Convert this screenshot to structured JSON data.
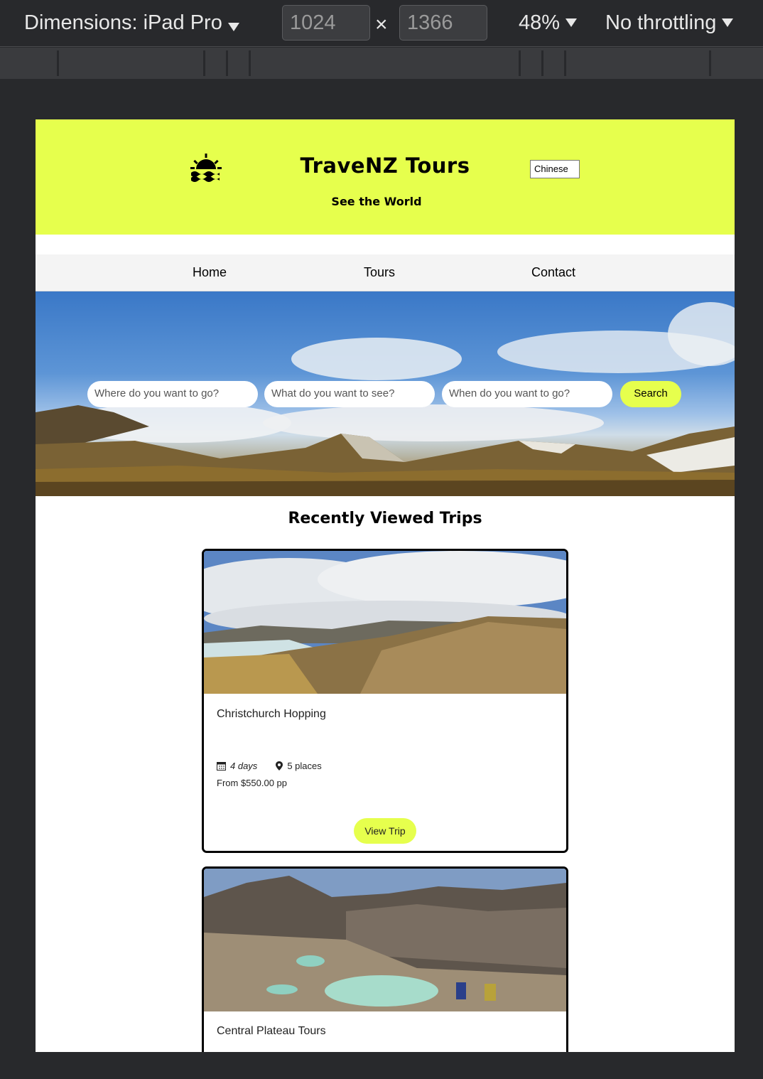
{
  "devtools": {
    "dimensions_label": "Dimensions: iPad Pro",
    "width": "1024",
    "height": "1366",
    "times": "×",
    "zoom": "48%",
    "throttling": "No throttling"
  },
  "header": {
    "title": "TraveNZ Tours",
    "tagline": "See the World",
    "language": "Chinese"
  },
  "nav": {
    "items": [
      "Home",
      "Tours",
      "Contact"
    ]
  },
  "search": {
    "where_placeholder": "Where do you want to go?",
    "what_placeholder": "What do you want to see?",
    "when_placeholder": "When do you want to go?",
    "button_label": "Search"
  },
  "recent": {
    "title": "Recently Viewed Trips",
    "trips": [
      {
        "name": "Christchurch Hopping",
        "days": "4 days",
        "places": "5 places",
        "price": "From $550.00 pp",
        "button": "View Trip"
      },
      {
        "name": "Central Plateau Tours"
      }
    ]
  },
  "colors": {
    "accent": "#e6ff4d",
    "devtools_bg": "#28292c"
  }
}
